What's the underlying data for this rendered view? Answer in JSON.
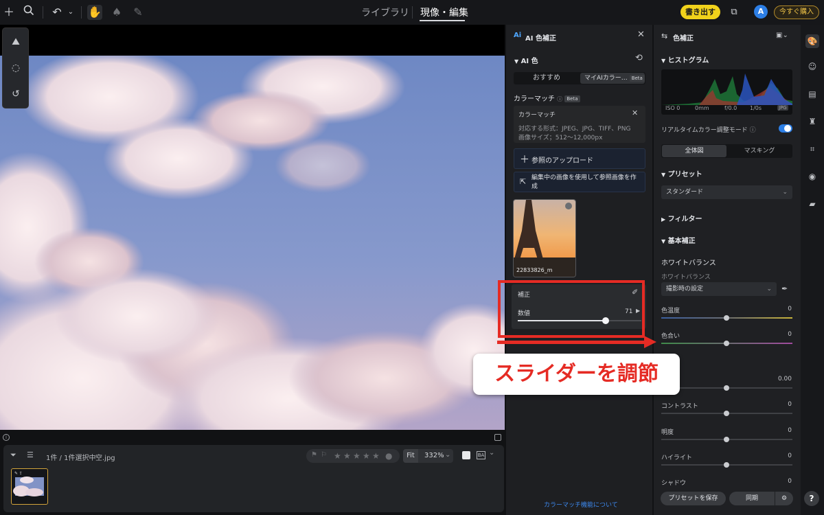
{
  "topbar": {
    "tabs": [
      "ライブラリ",
      "現像・編集"
    ],
    "active_tab": "現像・編集",
    "export_label": "書き出す",
    "avatar_letter": "A",
    "buy_label": "今すぐ購入",
    "icons": [
      "plus-icon",
      "search-icon",
      "undo-icon",
      "chevron-down-icon",
      "hand-icon",
      "stamp-icon",
      "brush-icon",
      "compare-icon"
    ]
  },
  "left_tools": {
    "icons": [
      "ai-landscape-icon",
      "vignette-icon",
      "history-icon"
    ]
  },
  "filmstrip": {
    "count_text": "1件 / 1件選択中",
    "filename": "空.jpg",
    "fit_label": "Fit",
    "zoom": "332%",
    "star_count": 5,
    "rating": 0
  },
  "ai_panel": {
    "title": "AI 色補正",
    "logo": "Ai",
    "ai_color_heading": "AI 色",
    "tab_recommended": "おすすめ",
    "tab_my_ai": "マイAIカラー…",
    "beta": "Beta",
    "color_match_heading": "カラーマッチ",
    "color_match_box_title": "カラーマッチ",
    "formats_line": "対応する形式：JPEG、JPG、TIFF、PNG",
    "size_line": "画像サイズ；512〜12,000px",
    "upload_btn": "参照のアップロード",
    "create_ref_btn": "編集中の画像を使用して参照画像を作成",
    "ref_filename": "22833826_m",
    "correction_label": "補正",
    "value_label": "数値",
    "value": "71",
    "slider_value": 71,
    "slider_max": 100,
    "about_link": "カラーマッチ機能について"
  },
  "callout": {
    "text": "スライダーを調節",
    "color": "#e52b24"
  },
  "right_panel": {
    "title": "色補正",
    "histogram_heading": "ヒストグラム",
    "histo_meta": [
      "ISO 0",
      "0mm",
      "f/0.0",
      "1/0s",
      "JPG"
    ],
    "realtime_label": "リアルタイムカラー調整モード",
    "realtime_on": true,
    "seg_all": "全体図",
    "seg_mask": "マスキング",
    "preset_heading": "プリセット",
    "preset_value": "スタンダード",
    "filter_heading": "フィルター",
    "basic_heading": "基本補正",
    "wb_heading": "ホワイトバランス",
    "wb_sub": "ホワイトバランス",
    "wb_value": "撮影時の設定",
    "temp_label": "色温度",
    "temp_value": "0",
    "tint_label": "色合い",
    "tint_value": "0",
    "exposure_value": "0.00",
    "contrast_label": "コントラスト",
    "contrast_value": "0",
    "brightness_label": "明度",
    "brightness_value": "0",
    "highlight_label": "ハイライト",
    "highlight_value": "0",
    "shadow_label": "シャドウ",
    "shadow_value": "0",
    "save_preset": "プリセットを保存",
    "sync": "同期"
  },
  "rail": {
    "icons": [
      "palette-icon",
      "portrait-icon",
      "gradient-icon",
      "clothing-icon",
      "crop-icon",
      "camera-icon",
      "folder-settings-icon"
    ],
    "help": "?"
  }
}
